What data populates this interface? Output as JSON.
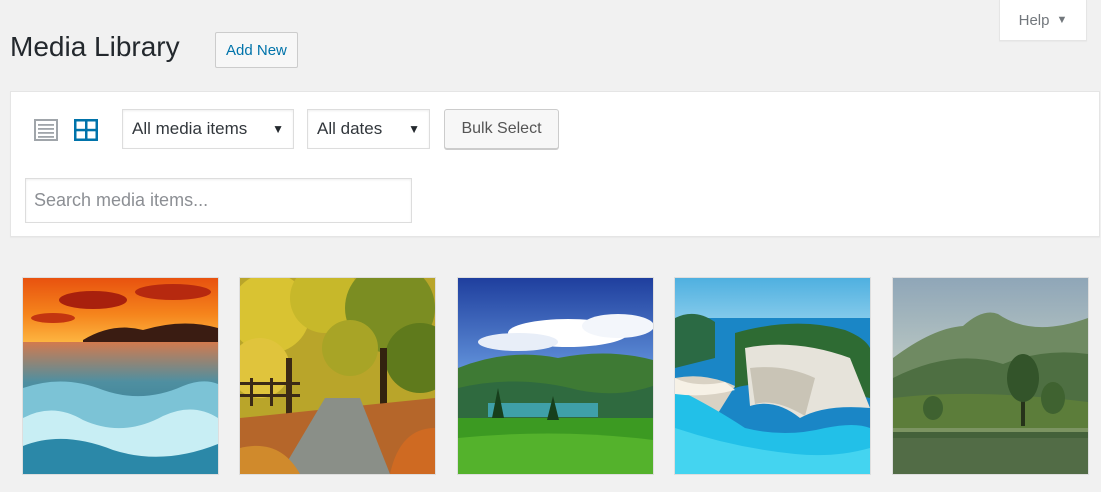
{
  "help": {
    "label": "Help",
    "caret": "▼"
  },
  "header": {
    "title": "Media Library",
    "add_new_label": "Add New"
  },
  "toolbar": {
    "view_modes": [
      {
        "name": "list",
        "icon": "list-view-icon",
        "active": false
      },
      {
        "name": "grid",
        "icon": "grid-view-icon",
        "active": true
      }
    ],
    "type_filter": {
      "value": "All media items",
      "caret": "▼"
    },
    "date_filter": {
      "value": "All dates",
      "caret": "▼"
    },
    "bulk_select_label": "Bulk Select",
    "search": {
      "placeholder": "Search media items...",
      "value": ""
    }
  },
  "colors": {
    "accent": "#0073aa",
    "background": "#f1f1f1",
    "panel": "#ffffff",
    "active_icon": "#0073aa",
    "inactive_icon": "#a0a5aa"
  },
  "media_items": [
    {
      "subject": "sunset-ocean-waves"
    },
    {
      "subject": "autumn-forest-path"
    },
    {
      "subject": "mountain-lake-clouds"
    },
    {
      "subject": "cliff-beach-lagoon"
    },
    {
      "subject": "misty-valley-lake"
    }
  ]
}
